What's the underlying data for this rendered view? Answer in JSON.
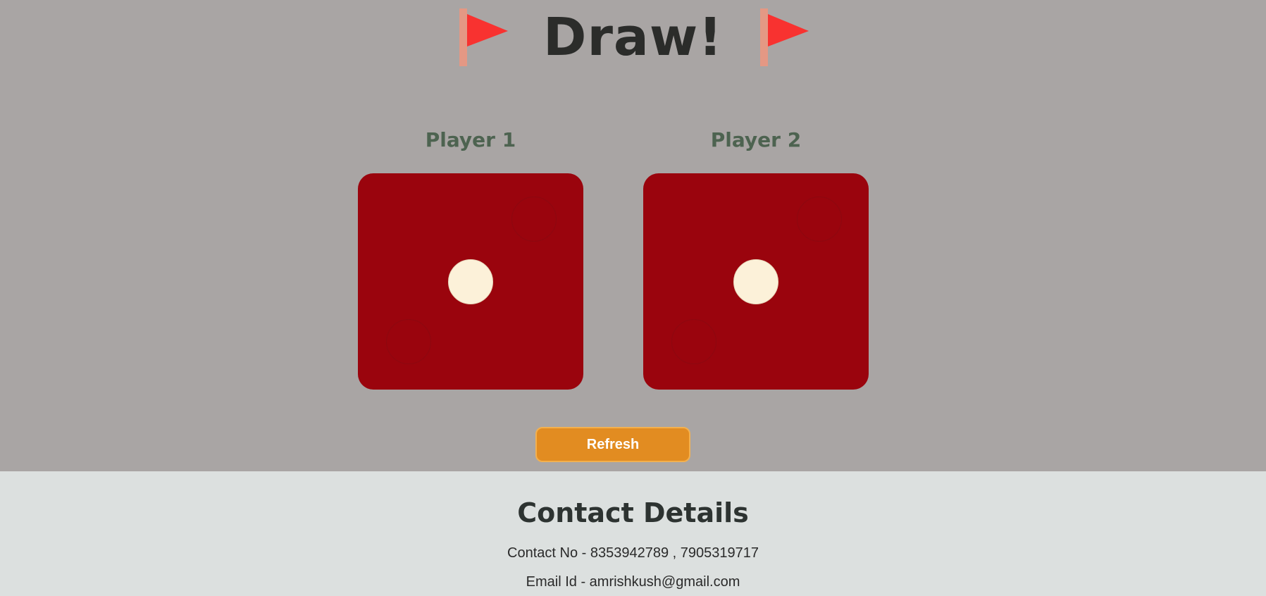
{
  "result": {
    "text": "Draw!",
    "flag_icon": "red-triangular-flag-icon"
  },
  "players": [
    {
      "label": "Player 1",
      "die_value": 1
    },
    {
      "label": "Player 2",
      "die_value": 1
    }
  ],
  "refresh_button": {
    "label": "Refresh"
  },
  "contact": {
    "title": "Contact Details",
    "phone": "Contact No - 8353942789 , 7905319717",
    "email": "Email Id - amrishkush@gmail.com"
  },
  "colors": {
    "background": "#a9a5a4",
    "die": "#9a040d",
    "pip": "#fcf1d9",
    "button": "#e28c21",
    "footer": "#dce0df",
    "player_label": "#4d6350"
  }
}
